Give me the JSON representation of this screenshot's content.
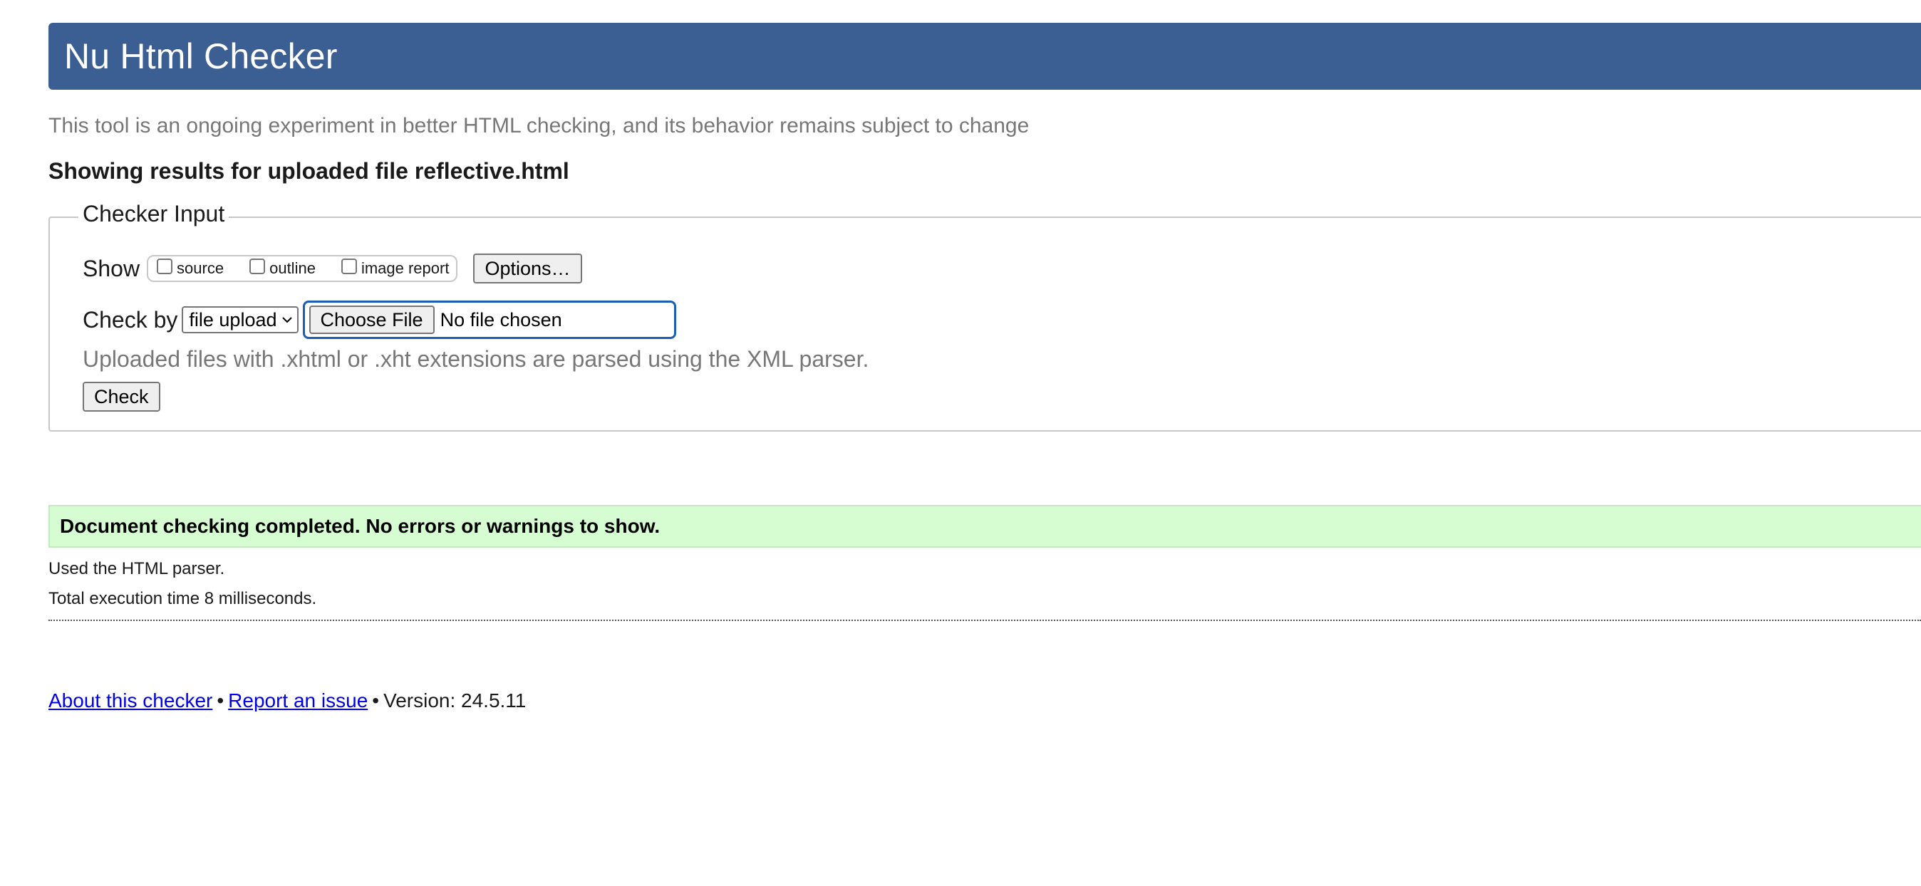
{
  "header": {
    "title": "Nu Html Checker"
  },
  "subtitle": "This tool is an ongoing experiment in better HTML checking, and its behavior remains subject to change",
  "results_heading": "Showing results for uploaded file reflective.html",
  "checker_input": {
    "legend": "Checker Input",
    "show_label": "Show",
    "checkboxes": [
      {
        "label": "source",
        "checked": false
      },
      {
        "label": "outline",
        "checked": false
      },
      {
        "label": "image report",
        "checked": false
      }
    ],
    "options_button": "Options…",
    "check_by_label": "Check by",
    "check_by_selected": "file upload",
    "choose_file_button": "Choose File",
    "file_status": "No file chosen",
    "hint": "Uploaded files with .xhtml or .xht extensions are parsed using the XML parser.",
    "check_button": "Check"
  },
  "result": {
    "message": "Document checking completed. No errors or warnings to show.",
    "parser": "Used the HTML parser.",
    "execution_time": "Total execution time 8 milliseconds."
  },
  "footer": {
    "about_link": "About this checker",
    "separator": "•",
    "report_link": "Report an issue",
    "version": "Version: 24.5.11"
  },
  "colors": {
    "header_bg": "#3c5f93",
    "success_bg": "#d6fcd1",
    "focus_ring": "#1a5fb4",
    "link": "#0000ee"
  }
}
